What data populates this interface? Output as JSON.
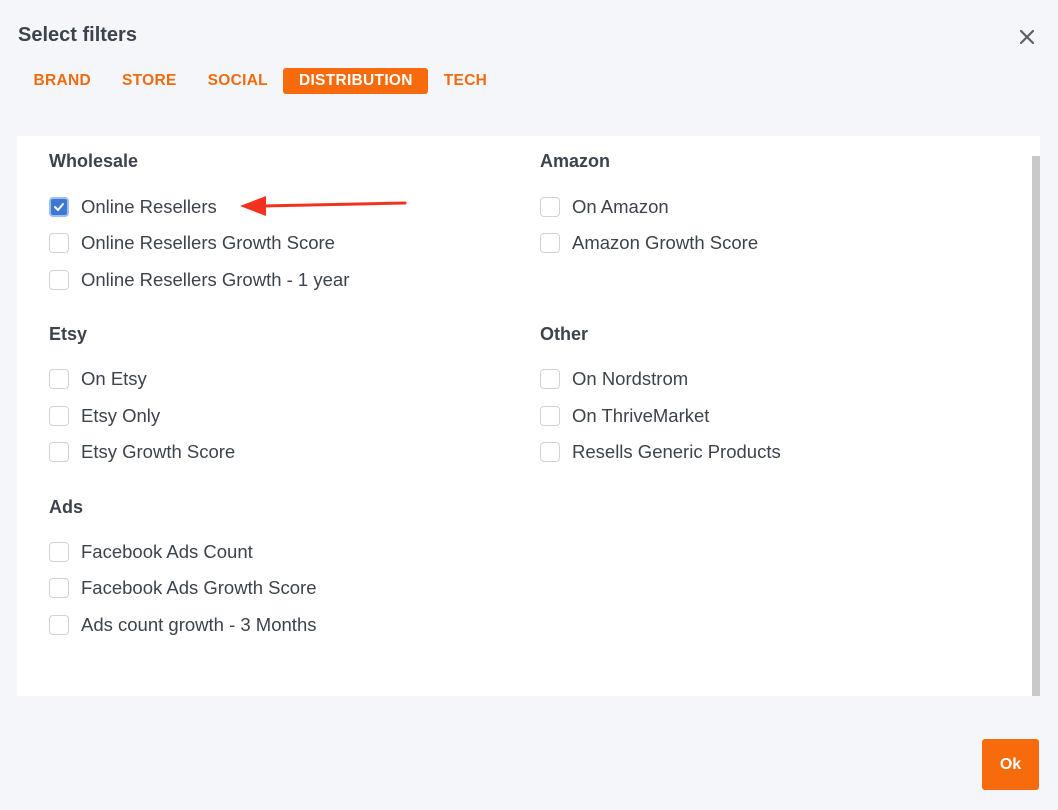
{
  "dialog": {
    "title": "Select filters",
    "close_icon": "close-icon",
    "ok_label": "Ok"
  },
  "tabs": [
    {
      "label": "BRAND",
      "active": false
    },
    {
      "label": "STORE",
      "active": false
    },
    {
      "label": "SOCIAL",
      "active": false
    },
    {
      "label": "DISTRIBUTION",
      "active": true
    },
    {
      "label": "TECH",
      "active": false
    }
  ],
  "groups": {
    "wholesale": {
      "title": "Wholesale",
      "options": [
        {
          "label": "Online Resellers",
          "checked": true
        },
        {
          "label": "Online Resellers Growth Score",
          "checked": false
        },
        {
          "label": "Online Resellers Growth - 1 year",
          "checked": false
        }
      ]
    },
    "amazon": {
      "title": "Amazon",
      "options": [
        {
          "label": "On Amazon",
          "checked": false
        },
        {
          "label": "Amazon Growth Score",
          "checked": false
        }
      ]
    },
    "etsy": {
      "title": "Etsy",
      "options": [
        {
          "label": "On Etsy",
          "checked": false
        },
        {
          "label": "Etsy Only",
          "checked": false
        },
        {
          "label": "Etsy Growth Score",
          "checked": false
        }
      ]
    },
    "other": {
      "title": "Other",
      "options": [
        {
          "label": "On Nordstrom",
          "checked": false
        },
        {
          "label": "On ThriveMarket",
          "checked": false
        },
        {
          "label": "Resells Generic Products",
          "checked": false
        }
      ]
    },
    "ads": {
      "title": "Ads",
      "options": [
        {
          "label": "Facebook Ads Count",
          "checked": false
        },
        {
          "label": "Facebook Ads Growth Score",
          "checked": false
        },
        {
          "label": "Ads count growth - 3 Months",
          "checked": false
        }
      ]
    }
  },
  "colors": {
    "accent": "#f76b0c",
    "checkbox_checked": "#3d79d2",
    "annotation_arrow": "#f0321e"
  },
  "annotation": {
    "icon": "arrow-left-icon"
  }
}
